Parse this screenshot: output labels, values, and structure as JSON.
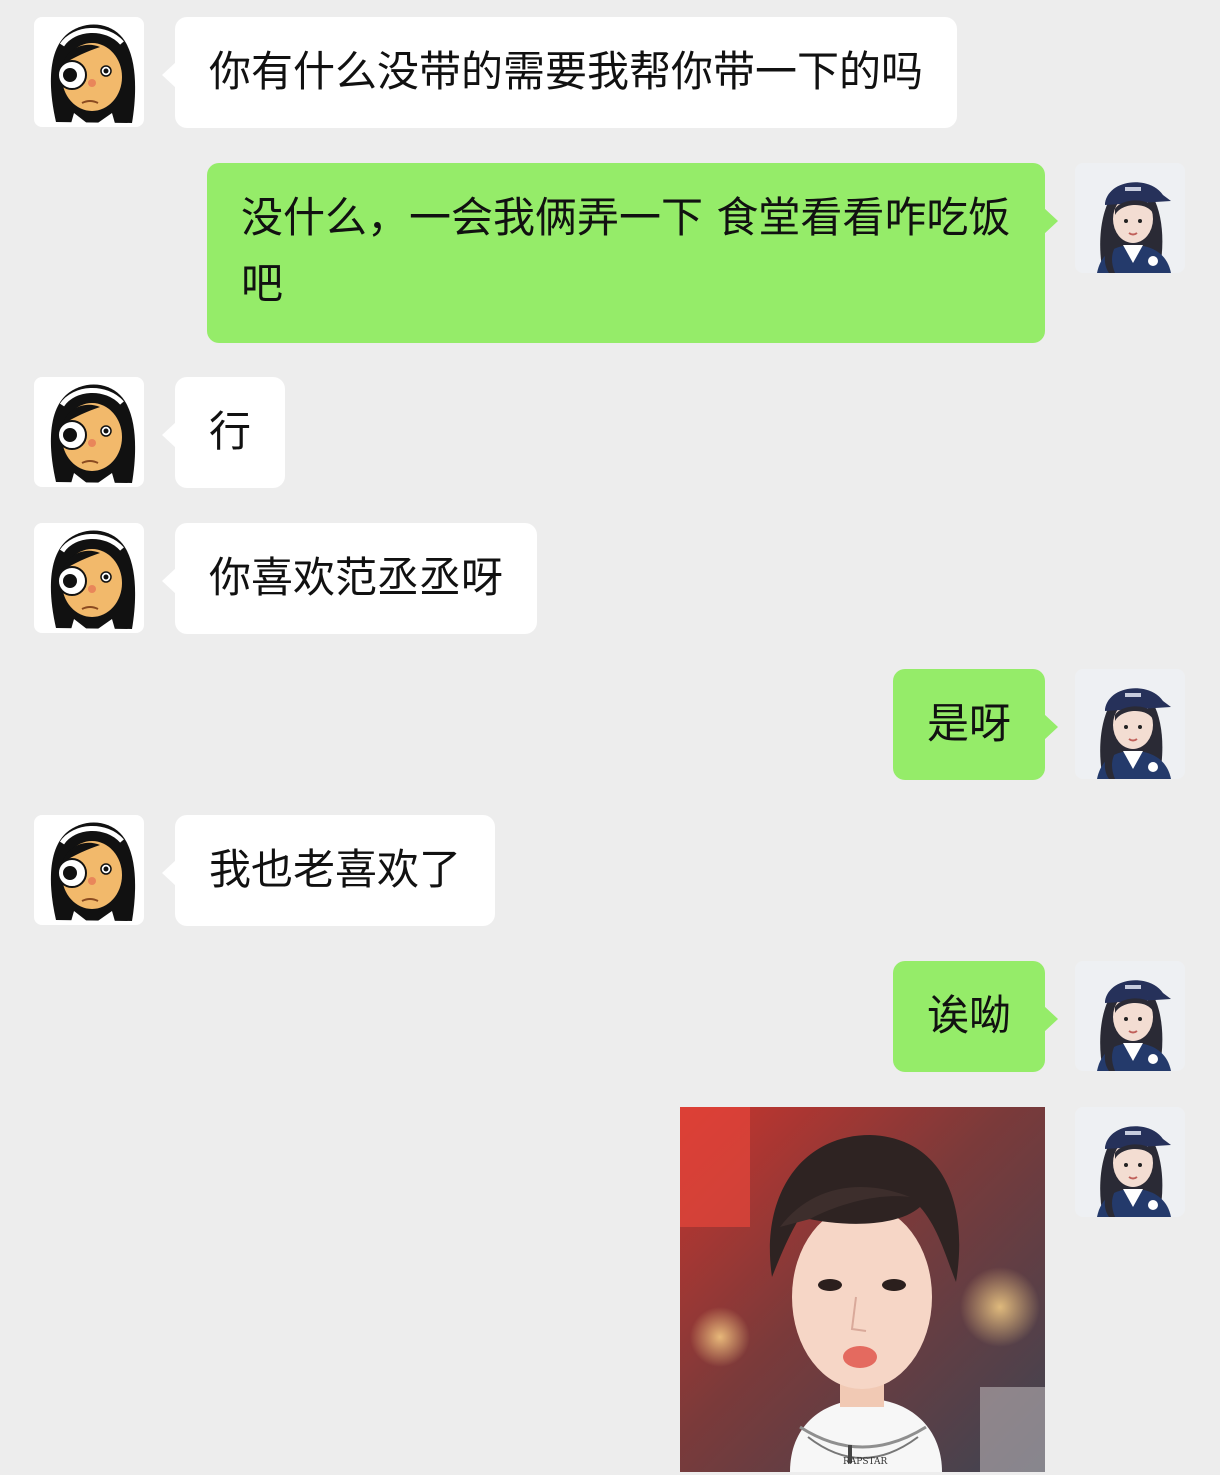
{
  "chat": {
    "messages": [
      {
        "side": "in",
        "text": "你有什么没带的需要我帮你带一下的吗"
      },
      {
        "side": "out",
        "text": "没什么，一会我俩弄一下 食堂看看咋吃饭吧"
      },
      {
        "side": "in",
        "text": "行"
      },
      {
        "side": "in",
        "text": "你喜欢范丞丞呀"
      },
      {
        "side": "out",
        "text": "是呀"
      },
      {
        "side": "in",
        "text": "我也老喜欢了"
      },
      {
        "side": "out",
        "text": "诶呦"
      },
      {
        "side": "out",
        "type": "image",
        "image_text": "RAPSTAR"
      }
    ]
  },
  "colors": {
    "background": "#ededed",
    "incoming_bubble": "#ffffff",
    "outgoing_bubble": "#95ec69"
  },
  "icons": {
    "incoming_avatar": "cartoon-girl-avatar-icon",
    "outgoing_avatar": "girl-in-cap-avatar-icon"
  }
}
